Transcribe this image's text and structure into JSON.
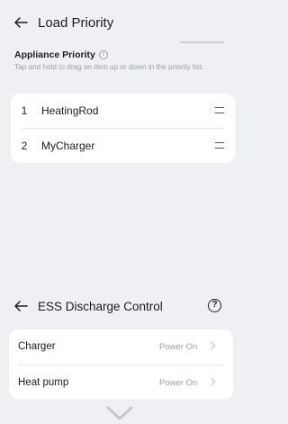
{
  "load_priority": {
    "title": "Load Priority",
    "section_label": "Appliance Priority",
    "hint": "Tap and hold to drag an item up or down in the priority list.",
    "items": [
      {
        "index": "1",
        "name": "HeatingRod"
      },
      {
        "index": "2",
        "name": "MyCharger"
      }
    ]
  },
  "ess": {
    "title": "ESS Discharge Control",
    "help_glyph": "?",
    "rows": [
      {
        "name": "Charger",
        "status": "Power On"
      },
      {
        "name": "Heat pump",
        "status": "Power On"
      }
    ]
  },
  "icons": {
    "back": "arrow-left-icon",
    "info": "info-icon",
    "drag": "drag-handle-icon",
    "help": "help-icon",
    "chevron": "chevron-right-icon",
    "collapse": "chevron-down-icon"
  },
  "colors": {
    "background": "#eef0f4",
    "card": "#ffffff",
    "text": "#1c1c1e",
    "muted": "#9aa0a6"
  }
}
